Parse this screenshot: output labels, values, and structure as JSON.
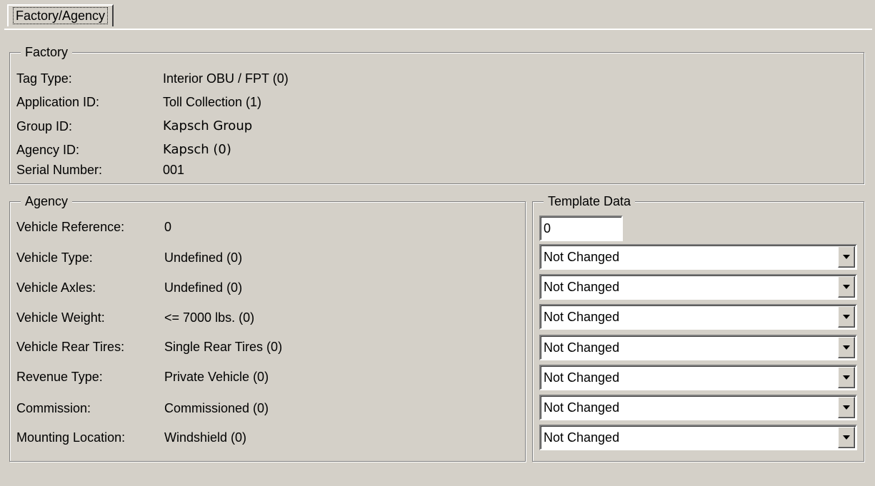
{
  "tab": {
    "label": "Factory/Agency"
  },
  "factory": {
    "legend": "Factory",
    "rows": [
      {
        "label": "Tag Type:",
        "value": "Interior OBU / FPT (0)"
      },
      {
        "label": "Application ID:",
        "value": "Toll Collection (1)"
      },
      {
        "label": "Group ID:",
        "value": "Kapsch Group"
      },
      {
        "label": "Agency ID:",
        "value": "Kapsch (0)"
      },
      {
        "label": "Serial Number:",
        "value": "001"
      }
    ]
  },
  "agency": {
    "legend": "Agency",
    "rows": [
      {
        "label": "Vehicle Reference:",
        "value": "0"
      },
      {
        "label": "Vehicle Type:",
        "value": "Undefined (0)"
      },
      {
        "label": "Vehicle Axles:",
        "value": "Undefined (0)"
      },
      {
        "label": "Vehicle Weight:",
        "value": "<= 7000 lbs. (0)"
      },
      {
        "label": "Vehicle Rear Tires:",
        "value": "Single Rear Tires (0)"
      },
      {
        "label": "Revenue Type:",
        "value": "Private Vehicle (0)"
      },
      {
        "label": "Commission:",
        "value": "Commissioned (0)"
      },
      {
        "label": "Mounting Location:",
        "value": "Windshield (0)"
      }
    ]
  },
  "template": {
    "legend": "Template Data",
    "reference_value": "0",
    "selects": [
      {
        "value": "Not Changed"
      },
      {
        "value": "Not Changed"
      },
      {
        "value": "Not Changed"
      },
      {
        "value": "Not Changed"
      },
      {
        "value": "Not Changed"
      },
      {
        "value": "Not Changed"
      },
      {
        "value": "Not Changed"
      }
    ]
  }
}
